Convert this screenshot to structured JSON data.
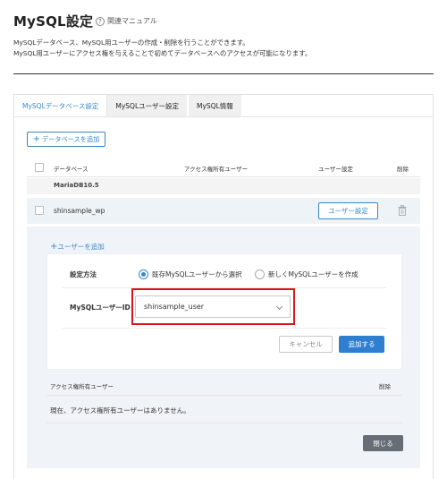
{
  "page": {
    "title": "MySQL設定",
    "help_label": "関連マニュアル",
    "description": [
      "MySQLデータベース、MySQL用ユーザーの作成・削除を行うことができます。",
      "MySQL用ユーザーにアクセス権を与えることで初めてデータベースへのアクセスが可能になります。"
    ]
  },
  "tabs": [
    {
      "label": "MySQLデータベース設定",
      "active": true
    },
    {
      "label": "MySQLユーザー設定",
      "active": false
    },
    {
      "label": "MySQL情報",
      "active": false
    }
  ],
  "toolbar": {
    "add_database_label": "データベースを追加"
  },
  "table": {
    "headers": {
      "database": "データベース",
      "access_users": "アクセス権所有ユーザー",
      "user_settings": "ユーザー設定",
      "delete": "削除"
    },
    "group_label": "MariaDB10.5",
    "rows": [
      {
        "name": "shinsample_wp",
        "user_settings_label": "ユーザー設定"
      }
    ]
  },
  "user_panel": {
    "add_user_label": "ユーザーを追加",
    "method_label": "設定方法",
    "options": [
      {
        "label": "既存MySQLユーザーから選択",
        "selected": true
      },
      {
        "label": "新しくMySQLユーザーを作成",
        "selected": false
      }
    ],
    "user_id_label": "MySQLユーザーID",
    "selected_user": "shinsample_user",
    "cancel_label": "キャンセル",
    "submit_label": "追加する"
  },
  "access_section": {
    "header": "アクセス権所有ユーザー",
    "delete_header": "削除",
    "empty_message": "現在、アクセス権所有ユーザーはありません。",
    "close_label": "閉じる"
  },
  "colors": {
    "accent": "#3a87c8",
    "primary_button": "#2f7fd0",
    "highlight_border": "#d8151c",
    "close_button": "#666d75"
  }
}
